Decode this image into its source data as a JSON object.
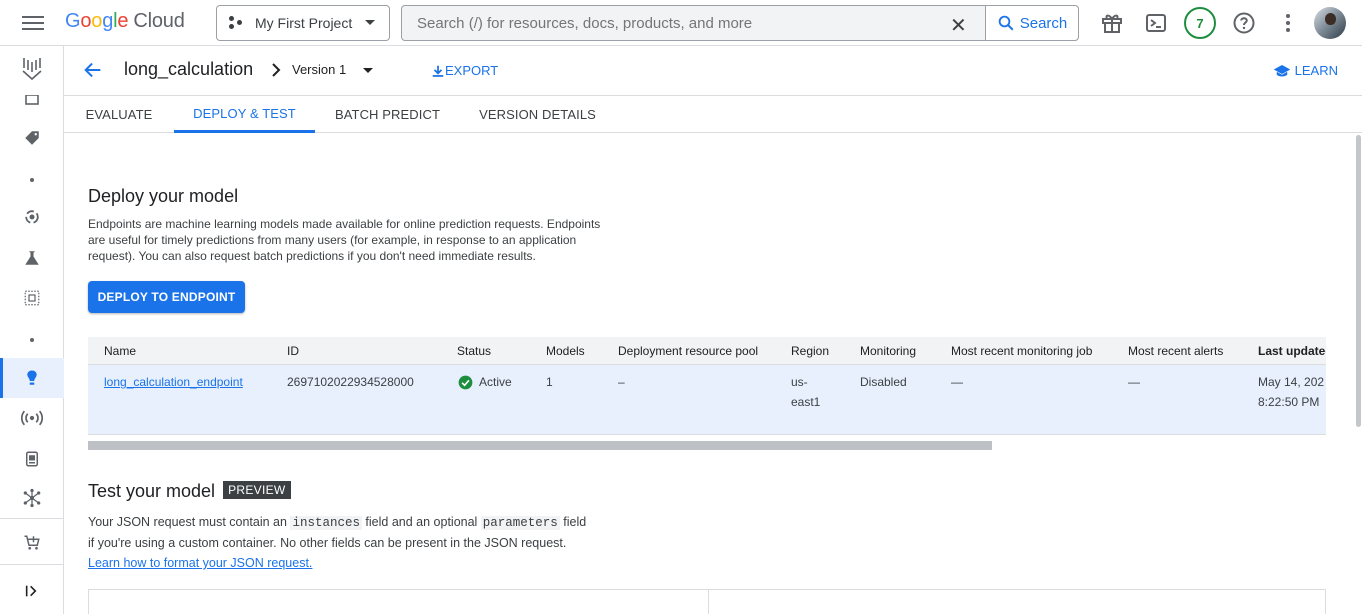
{
  "topbar": {
    "logo": {
      "g": "G",
      "o1": "o",
      "o2": "o",
      "g2": "g",
      "l": "l",
      "e": "e",
      "cloud": "Cloud"
    },
    "project": "My First Project",
    "search_placeholder": "Search (/) for resources, docs, products, and more",
    "search_button": "Search",
    "notifications_count": "7"
  },
  "subheader": {
    "title": "long_calculation",
    "version": "Version 1",
    "export": "EXPORT",
    "learn": "LEARN"
  },
  "tabs": [
    "EVALUATE",
    "DEPLOY & TEST",
    "BATCH PREDICT",
    "VERSION DETAILS"
  ],
  "deploy": {
    "heading": "Deploy your model",
    "description_lines": [
      "Endpoints are machine learning models made available for online prediction requests. Endpoints",
      "are useful for timely predictions from many users (for example, in response to an application",
      "request). You can also request batch predictions if you don't need immediate results."
    ],
    "button": "DEPLOY TO ENDPOINT"
  },
  "endpoints_table": {
    "columns": [
      "Name",
      "ID",
      "Status",
      "Models",
      "Deployment resource pool",
      "Region",
      "Monitoring",
      "Most recent monitoring job",
      "Most recent alerts",
      "Last updated"
    ],
    "rows": [
      {
        "name": "long_calculation_endpoint",
        "id": "2697102022934528000",
        "status": "Active",
        "models": "1",
        "pool": "–",
        "region_l1": "us-",
        "region_l2": "east1",
        "monitoring": "Disabled",
        "monitoring_job": "—",
        "alerts": "—",
        "updated_l1": "May 14, 202",
        "updated_l2": "8:22:50 PM"
      }
    ]
  },
  "test": {
    "heading": "Test your model",
    "badge": "PREVIEW",
    "line1_a": "Your JSON request must contain an ",
    "line1_code1": "instances",
    "line1_b": " field and an optional ",
    "line1_code2": "parameters",
    "line1_c": " field",
    "line2": "if you're using a custom container. No other fields can be present in the JSON request.",
    "link": "Learn how to format your JSON request."
  },
  "colors": {
    "accent": "#1a73e8",
    "active_row": "#e8f0fe",
    "status_green": "#1e8e3e"
  }
}
